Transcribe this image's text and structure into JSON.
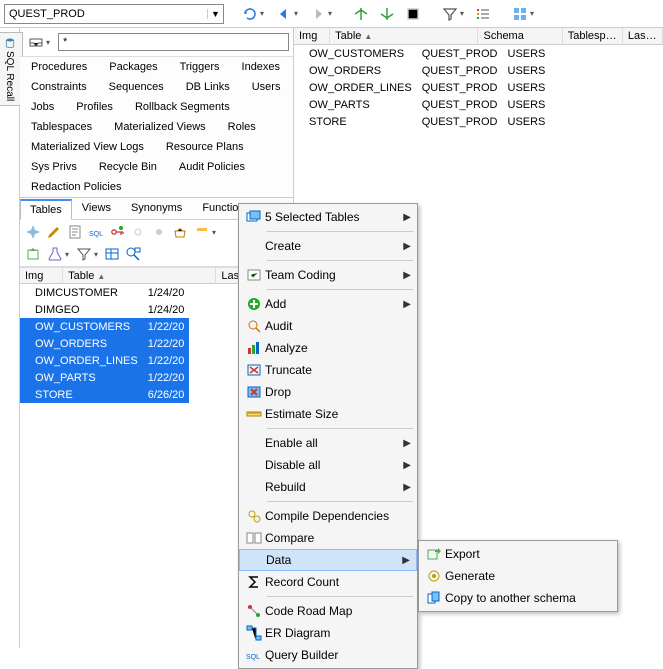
{
  "top": {
    "connection": "QUEST_PROD",
    "filter_text": "*"
  },
  "sql_recall_label": "SQL Recall",
  "categories": [
    "Procedures",
    "Packages",
    "Triggers",
    "Indexes",
    "Constraints",
    "Sequences",
    "DB Links",
    "Users",
    "Jobs",
    "Profiles",
    "Rollback Segments",
    "Tablespaces",
    "Materialized Views",
    "Roles",
    "Materialized View Logs",
    "Resource Plans",
    "Sys Privs",
    "Recycle Bin",
    "Audit Policies",
    "Redaction Policies"
  ],
  "sub_tabs": [
    "Tables",
    "Views",
    "Synonyms",
    "Functions"
  ],
  "active_sub_tab": "Tables",
  "left_grid": {
    "headers": {
      "img": "Img",
      "table": "Table",
      "last_ddl": "Last DDL"
    },
    "rows": [
      {
        "table": "DIMCUSTOMER",
        "last_ddl": "1/24/20",
        "selected": false
      },
      {
        "table": "DIMGEO",
        "last_ddl": "1/24/20",
        "selected": false
      },
      {
        "table": "OW_CUSTOMERS",
        "last_ddl": "1/22/20",
        "selected": true
      },
      {
        "table": "OW_ORDERS",
        "last_ddl": "1/22/20",
        "selected": true
      },
      {
        "table": "OW_ORDER_LINES",
        "last_ddl": "1/22/20",
        "selected": true
      },
      {
        "table": "OW_PARTS",
        "last_ddl": "1/22/20",
        "selected": true
      },
      {
        "table": "STORE",
        "last_ddl": "6/26/20",
        "selected": true
      }
    ]
  },
  "right_grid": {
    "headers": {
      "img": "Img",
      "table": "Table",
      "schema": "Schema",
      "tablespace": "Tablespace",
      "last_an": "Last An"
    },
    "rows": [
      {
        "table": "OW_CUSTOMERS",
        "schema": "QUEST_PROD",
        "tablespace": "USERS"
      },
      {
        "table": "OW_ORDERS",
        "schema": "QUEST_PROD",
        "tablespace": "USERS"
      },
      {
        "table": "OW_ORDER_LINES",
        "schema": "QUEST_PROD",
        "tablespace": "USERS"
      },
      {
        "table": "OW_PARTS",
        "schema": "QUEST_PROD",
        "tablespace": "USERS"
      },
      {
        "table": "STORE",
        "schema": "QUEST_PROD",
        "tablespace": "USERS"
      }
    ]
  },
  "context_menu": {
    "selected_count_label": "5 Selected Tables",
    "items": {
      "create": "Create",
      "team_coding": "Team Coding",
      "add": "Add",
      "audit": "Audit",
      "analyze": "Analyze",
      "truncate": "Truncate",
      "drop": "Drop",
      "estimate_size": "Estimate Size",
      "enable_all": "Enable all",
      "disable_all": "Disable all",
      "rebuild": "Rebuild",
      "compile_deps": "Compile Dependencies",
      "compare": "Compare",
      "data": "Data",
      "record_count": "Record Count",
      "code_road_map": "Code Road Map",
      "er_diagram": "ER Diagram",
      "query_builder": "Query Builder"
    },
    "sub_items": {
      "export": "Export",
      "generate": "Generate",
      "copy_schema": "Copy to another schema"
    }
  }
}
